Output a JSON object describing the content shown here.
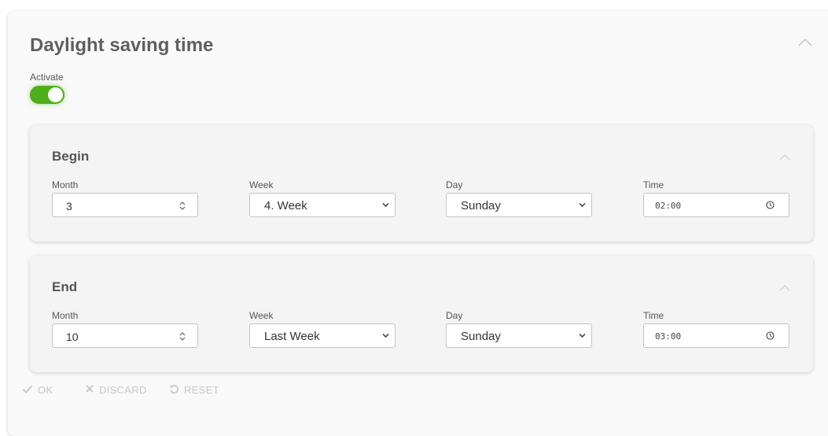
{
  "section": {
    "title": "Daylight saving time",
    "activate_label": "Activate",
    "activate_on": true
  },
  "begin": {
    "title": "Begin",
    "month_label": "Month",
    "month_value": "3",
    "week_label": "Week",
    "week_value": "4. Week",
    "day_label": "Day",
    "day_value": "Sunday",
    "time_label": "Time",
    "time_value": "02:00"
  },
  "end": {
    "title": "End",
    "month_label": "Month",
    "month_value": "10",
    "week_label": "Week",
    "week_value": "Last Week",
    "day_label": "Day",
    "day_value": "Sunday",
    "time_label": "Time",
    "time_value": "03:00"
  },
  "actions": {
    "ok": "OK",
    "discard": "DISCARD",
    "reset": "RESET"
  },
  "colors": {
    "accent": "#4caf1a",
    "disabled": "#c8c8c8"
  },
  "icons": {
    "collapse": "chevron-up-icon",
    "stepper": "stepper-arrows-icon",
    "dropdown": "chevron-down-icon",
    "clock": "clock-icon",
    "ok": "check-icon",
    "discard": "close-icon",
    "reset": "undo-icon"
  }
}
